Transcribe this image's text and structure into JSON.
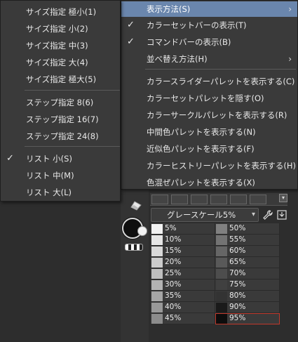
{
  "left_menu": {
    "items": [
      {
        "label": "サイズ指定 極小(1)",
        "checked": false
      },
      {
        "label": "サイズ指定 小(2)",
        "checked": false
      },
      {
        "label": "サイズ指定 中(3)",
        "checked": false
      },
      {
        "label": "サイズ指定 大(4)",
        "checked": false
      },
      {
        "label": "サイズ指定 極大(5)",
        "checked": false
      },
      {
        "label": "ステップ指定 8(6)",
        "checked": false
      },
      {
        "label": "ステップ指定 16(7)",
        "checked": false
      },
      {
        "label": "ステップ指定 24(8)",
        "checked": false
      },
      {
        "label": "リスト 小(S)",
        "checked": true
      },
      {
        "label": "リスト 中(M)",
        "checked": false
      },
      {
        "label": "リスト 大(L)",
        "checked": false
      }
    ]
  },
  "right_menu": {
    "items": [
      {
        "label": "表示方法(S)",
        "checked": false,
        "submenu": true,
        "highlighted": true
      },
      {
        "label": "カラーセットバーの表示(T)",
        "checked": true
      },
      {
        "label": "コマンドバーの表示(B)",
        "checked": true
      },
      {
        "label": "並べ替え方法(H)",
        "checked": false,
        "submenu": true
      },
      {
        "label": "カラースライダーパレットを表示する(C)",
        "checked": false
      },
      {
        "label": "カラーセットパレットを隠す(O)",
        "checked": false
      },
      {
        "label": "カラーサークルパレットを表示する(R)",
        "checked": false
      },
      {
        "label": "中間色パレットを表示する(N)",
        "checked": false
      },
      {
        "label": "近似色パレットを表示する(F)",
        "checked": false
      },
      {
        "label": "カラーヒストリーパレットを表示する(H)",
        "checked": false
      },
      {
        "label": "色混ぜパレットを表示する(X)",
        "checked": false
      }
    ],
    "check_glyph": "✓",
    "arrow_glyph": "›"
  },
  "color_set": {
    "selected_set": "グレースケール5%",
    "swatches_left": [
      {
        "label": "5%",
        "color": "#f2f2f2"
      },
      {
        "label": "10%",
        "color": "#e6e6e6"
      },
      {
        "label": "15%",
        "color": "#d9d9d9"
      },
      {
        "label": "20%",
        "color": "#cccccc"
      },
      {
        "label": "25%",
        "color": "#bfbfbf"
      },
      {
        "label": "30%",
        "color": "#b3b3b3"
      },
      {
        "label": "35%",
        "color": "#a6a6a6"
      },
      {
        "label": "40%",
        "color": "#999999"
      },
      {
        "label": "45%",
        "color": "#8c8c8c"
      }
    ],
    "swatches_right": [
      {
        "label": "50%",
        "color": "#808080"
      },
      {
        "label": "55%",
        "color": "#737373"
      },
      {
        "label": "60%",
        "color": "#666666"
      },
      {
        "label": "65%",
        "color": "#595959"
      },
      {
        "label": "70%",
        "color": "#4d4d4d"
      },
      {
        "label": "75%",
        "color": "#404040"
      },
      {
        "label": "80%",
        "color": "#333333"
      },
      {
        "label": "90%",
        "color": "#1a1a1a"
      },
      {
        "label": "95%",
        "color": "#0d0d0d",
        "selected": true
      }
    ],
    "main_color": "#0f0f0f",
    "sub_color": "#f2f2f2",
    "highlight_color": "#6a86ad",
    "selection_outline": "#c0392b"
  }
}
